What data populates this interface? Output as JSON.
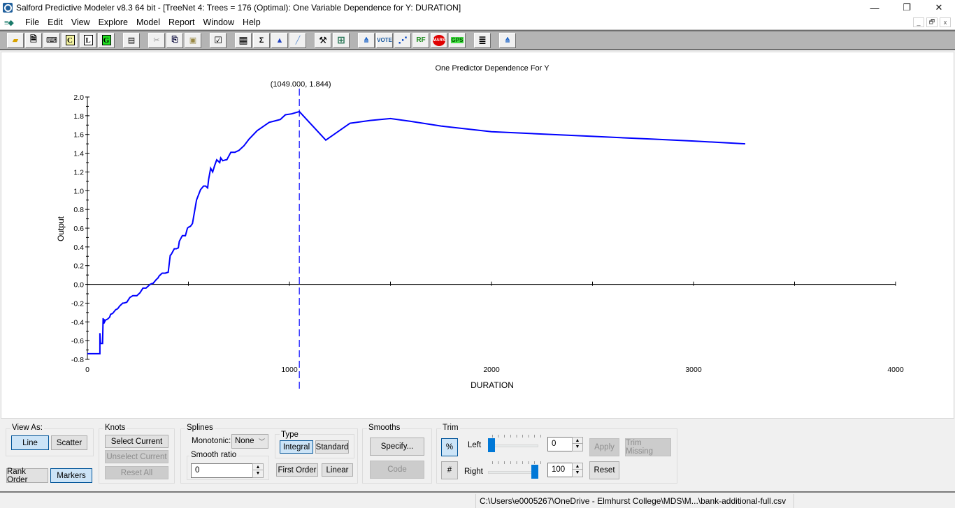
{
  "window": {
    "title": "Salford Predictive Modeler v8.3 64 bit - [TreeNet 4: Trees = 176 (Optimal): One Variable Dependence for Y: DURATION]",
    "controls": {
      "minimize": "—",
      "restore": "❐",
      "close": "✕"
    },
    "mdi_controls": {
      "minimize": "_",
      "restore": "🗗",
      "close": "x"
    }
  },
  "menu": {
    "items": [
      "File",
      "Edit",
      "View",
      "Explore",
      "Model",
      "Report",
      "Window",
      "Help"
    ]
  },
  "toolbar": {
    "buttons": [
      {
        "name": "open-icon",
        "glyph": "📂"
      },
      {
        "name": "open-report-icon",
        "glyph": "📋"
      },
      {
        "name": "command-icon",
        "glyph": "⌨"
      },
      {
        "name": "classic-output-icon",
        "glyph": "C"
      },
      {
        "name": "log-icon",
        "glyph": "L"
      },
      {
        "name": "grove-icon",
        "glyph": "G"
      },
      {
        "name": "print-icon",
        "glyph": "🖶"
      },
      {
        "name": "cut-icon",
        "glyph": "✂"
      },
      {
        "name": "copy-icon",
        "glyph": "⎘"
      },
      {
        "name": "paste-icon",
        "glyph": "📋"
      },
      {
        "name": "options-check-icon",
        "glyph": "☑"
      },
      {
        "name": "data-grid-icon",
        "glyph": "▦"
      },
      {
        "name": "data-stats-icon",
        "glyph": "Σ"
      },
      {
        "name": "histogram-icon",
        "glyph": "▲"
      },
      {
        "name": "graph-icon",
        "glyph": "╱"
      },
      {
        "name": "model-setup-icon",
        "glyph": "⚒"
      },
      {
        "name": "batteries-icon",
        "glyph": "⊞"
      },
      {
        "name": "cart-icon",
        "glyph": "⋔"
      },
      {
        "name": "vote-icon",
        "glyph": "🗳"
      },
      {
        "name": "treenet-icon",
        "glyph": "⋰"
      },
      {
        "name": "random-forests-icon",
        "glyph": "RF"
      },
      {
        "name": "mars-icon",
        "glyph": "MARS"
      },
      {
        "name": "gps-icon",
        "glyph": "GPS"
      },
      {
        "name": "notepad-icon",
        "glyph": "≣"
      },
      {
        "name": "score-icon",
        "glyph": "⋔"
      }
    ]
  },
  "chart_data": {
    "type": "line",
    "title": "One Predictor Dependence For Y",
    "xlabel": "DURATION",
    "ylabel": "Output",
    "xlim": [
      0,
      4000
    ],
    "ylim": [
      -0.8,
      2.0
    ],
    "x_ticks": [
      0,
      1000,
      2000,
      3000,
      4000
    ],
    "x_minor_ticks": [
      500,
      1500,
      2500,
      3500
    ],
    "y_ticks": [
      -0.8,
      -0.6,
      -0.4,
      -0.2,
      0.0,
      0.2,
      0.4,
      0.6,
      0.8,
      1.0,
      1.2,
      1.4,
      1.6,
      1.8,
      2.0
    ],
    "y_tick_labels": [
      "-0.8",
      "-0.6",
      "-0.4",
      "-0.2",
      "0.0",
      "0.2",
      "0.4",
      "0.6",
      "0.8",
      "1.0",
      "1.2",
      "1.4",
      "1.6",
      "1.8",
      "2.0"
    ],
    "marker": {
      "x": 1049,
      "y": 1.844,
      "label": "(1049.000, 1.844)"
    },
    "grid": false,
    "series": [
      {
        "name": "Y",
        "color": "#0000ff",
        "x": [
          0,
          62,
          62,
          65,
          65,
          75,
          78,
          80,
          82,
          85,
          90,
          100,
          110,
          115,
          125,
          140,
          150,
          160,
          175,
          180,
          195,
          210,
          225,
          230,
          245,
          255,
          260,
          275,
          290,
          300,
          310,
          320,
          325,
          340,
          350,
          355,
          370,
          375,
          385,
          400,
          410,
          415,
          430,
          440,
          450,
          455,
          470,
          485,
          495,
          500,
          510,
          520,
          540,
          560,
          575,
          585,
          590,
          595,
          600,
          610,
          620,
          630,
          640,
          655,
          660,
          670,
          685,
          690,
          710,
          730,
          750,
          775,
          800,
          840,
          900,
          920,
          955,
          980,
          1010,
          1049,
          1180,
          1300,
          1400,
          1500,
          1600,
          1750,
          2000,
          2200,
          2500,
          2800,
          3000,
          3256
        ],
        "y": [
          -0.74,
          -0.74,
          -0.52,
          -0.63,
          -0.63,
          -0.63,
          -0.36,
          -0.42,
          -0.37,
          -0.4,
          -0.38,
          -0.37,
          -0.35,
          -0.32,
          -0.31,
          -0.27,
          -0.26,
          -0.23,
          -0.2,
          -0.2,
          -0.19,
          -0.14,
          -0.12,
          -0.12,
          -0.12,
          -0.1,
          -0.09,
          -0.04,
          -0.04,
          -0.02,
          0.0,
          0.01,
          0.01,
          0.05,
          0.07,
          0.09,
          0.12,
          0.12,
          0.12,
          0.13,
          0.31,
          0.32,
          0.38,
          0.38,
          0.39,
          0.46,
          0.52,
          0.52,
          0.6,
          0.61,
          0.62,
          0.65,
          0.9,
          1.01,
          1.05,
          1.05,
          1.04,
          1.03,
          1.12,
          1.24,
          1.2,
          1.27,
          1.33,
          1.3,
          1.35,
          1.32,
          1.33,
          1.33,
          1.41,
          1.41,
          1.43,
          1.48,
          1.55,
          1.64,
          1.73,
          1.74,
          1.76,
          1.81,
          1.82,
          1.844,
          1.54,
          1.72,
          1.75,
          1.77,
          1.74,
          1.69,
          1.63,
          1.61,
          1.58,
          1.55,
          1.53,
          1.5
        ]
      }
    ]
  },
  "controls": {
    "view_as": {
      "label": "View As:",
      "line": "Line",
      "scatter": "Scatter",
      "selected": "Line"
    },
    "rank_order": "Rank Order",
    "markers": "Markers",
    "knots": {
      "label": "Knots",
      "select_current": "Select Current",
      "unselect_current": "Unselect Current",
      "reset_all": "Reset All"
    },
    "splines": {
      "label": "Splines",
      "monotonic_label": "Monotonic:",
      "monotonic_value": "None",
      "smooth_ratio_label": "Smooth ratio",
      "smooth_ratio_value": "0",
      "type_label": "Type",
      "integral": "Integral",
      "standard": "Standard",
      "type_selected": "Integral",
      "first_order": "First Order",
      "linear": "Linear"
    },
    "smooths": {
      "label": "Smooths",
      "specify": "Specify...",
      "code": "Code"
    },
    "trim": {
      "label": "Trim",
      "percent": "%",
      "hash": "#",
      "left_label": "Left",
      "right_label": "Right",
      "left_value": "0",
      "right_value": "100",
      "left_slider_fraction": 0.0,
      "right_slider_fraction": 1.0,
      "apply": "Apply",
      "trim_missing": "Trim Missing",
      "reset": "Reset"
    }
  },
  "statusbar": {
    "path": "C:\\Users\\e0005267\\OneDrive - Elmhurst College\\MDS\\M...\\bank-additional-full.csv"
  }
}
